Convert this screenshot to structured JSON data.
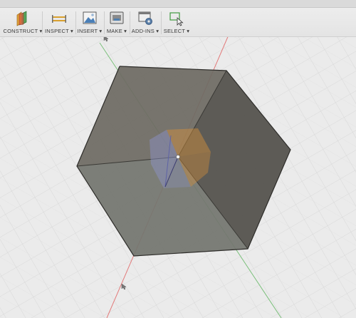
{
  "toolbar": {
    "buttons": [
      {
        "id": "construct",
        "label": "CONSTRUCT ▾",
        "icon": "construct-plane-icon"
      },
      {
        "id": "inspect",
        "label": "INSPECT ▾",
        "icon": "measure-ruler-icon"
      },
      {
        "id": "insert",
        "label": "INSERT ▾",
        "icon": "insert-image-icon"
      },
      {
        "id": "make",
        "label": "MAKE ▾",
        "icon": "make-3d-print-icon"
      },
      {
        "id": "addins",
        "label": "ADD-INS ▾",
        "icon": "addins-gear-icon"
      },
      {
        "id": "select",
        "label": "SELECT ▾",
        "icon": "select-arrow-icon"
      }
    ]
  },
  "viewport": {
    "object": "cube",
    "colors": {
      "background": "#e9e9e9",
      "grid": "#d2d2d2",
      "x_axis": "#e07070",
      "y_axis": "#5db05d",
      "cube_top": "#6d6a62",
      "cube_front": "#626059",
      "cube_right": "#4e4c47",
      "cube_left": "#7a7c78",
      "inner_orange": "#d9923a",
      "inner_blue": "#8a90c8"
    }
  }
}
